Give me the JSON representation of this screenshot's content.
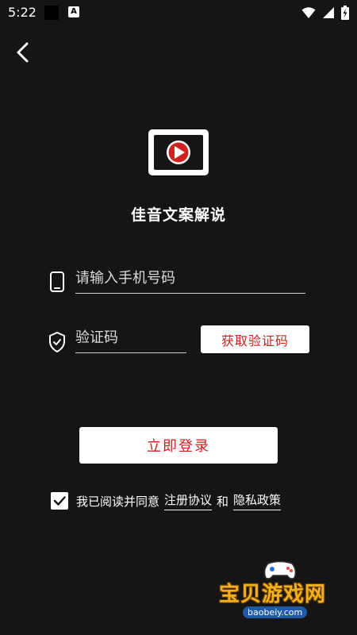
{
  "status_bar": {
    "time": "5:22",
    "a_badge": "A",
    "icons": [
      "wifi-icon",
      "signal-icon",
      "battery-icon"
    ]
  },
  "header": {
    "back_icon": "chevron-left-icon"
  },
  "app": {
    "title": "佳音文案解说",
    "logo_icon": "video-play-icon"
  },
  "form": {
    "phone_placeholder": "请输入手机号码",
    "phone_value": "",
    "code_placeholder": "验证码",
    "code_value": "",
    "get_code_label": "获取验证码",
    "login_label": "立即登录"
  },
  "agreement": {
    "checked": true,
    "prefix": "我已阅读并同意",
    "register_link": "注册协议",
    "and": "和",
    "privacy_link": "隐私政策"
  },
  "watermark": {
    "title": "宝贝游戏网",
    "url": "baobeiy.com"
  },
  "colors": {
    "background": "#151515",
    "accent_red": "#c8231f",
    "white": "#ffffff"
  }
}
